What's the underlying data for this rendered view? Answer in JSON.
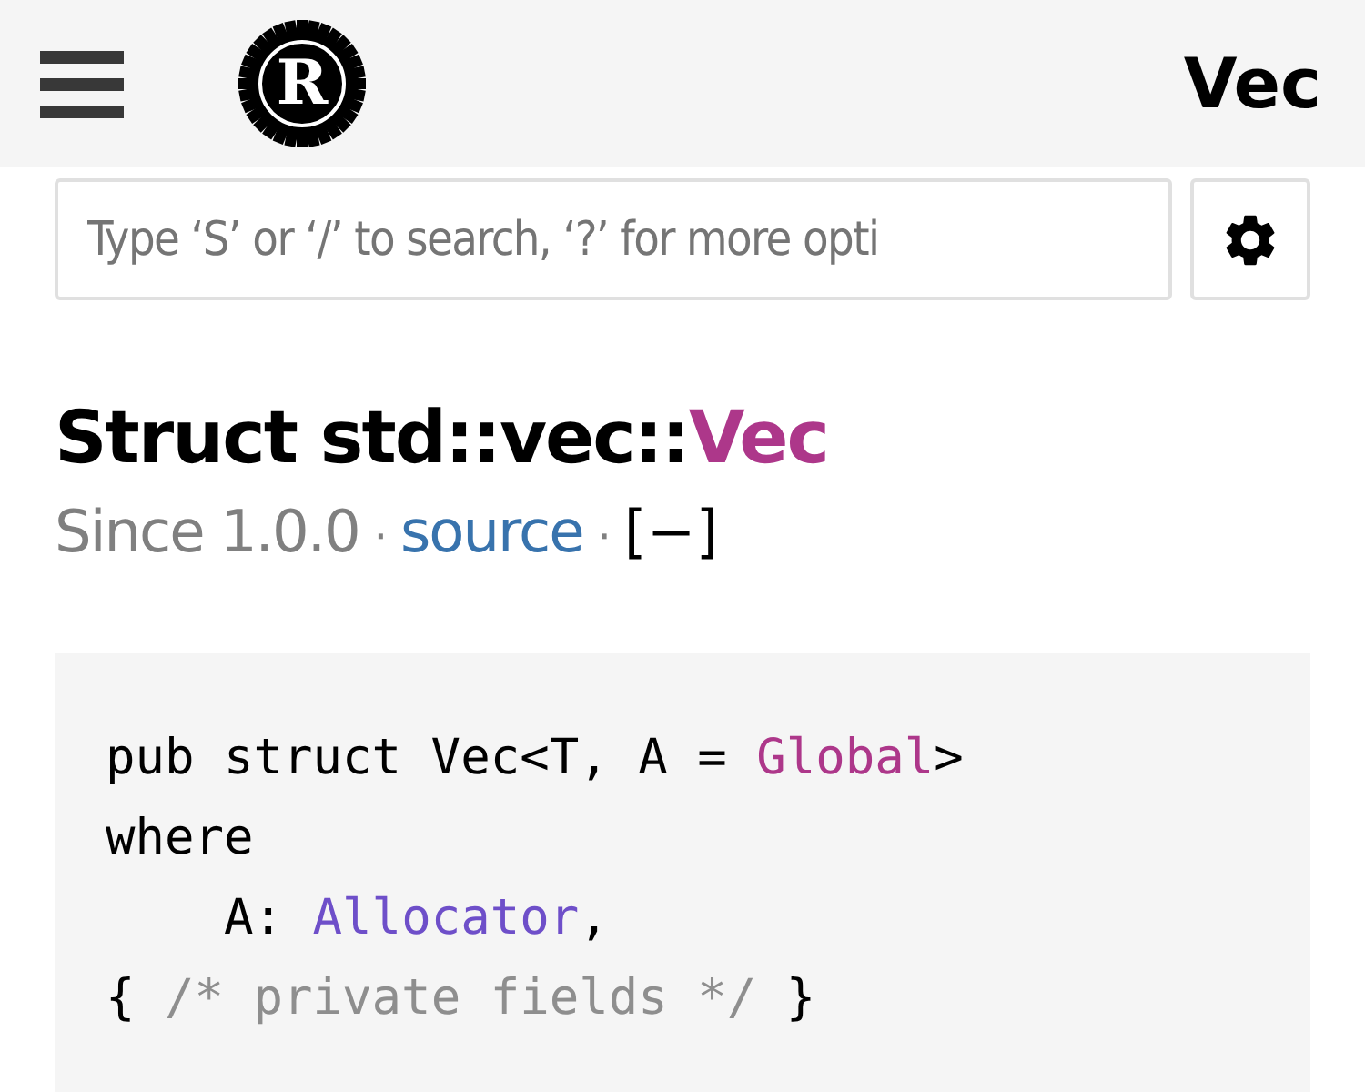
{
  "header": {
    "logo_letter": "R",
    "title": "Vec"
  },
  "search": {
    "placeholder": "Type ‘S’ or ‘/’ to search, ‘?’ for more opti"
  },
  "heading": {
    "prefix": "Struct std::vec::",
    "name": "Vec"
  },
  "meta": {
    "since": "Since 1.0.0",
    "separator": "·",
    "source_link": "source",
    "toggle": "[−]"
  },
  "code": [
    [
      {
        "kind": "plain",
        "text": "pub struct Vec<T, A = "
      },
      {
        "kind": "type",
        "text": "Global"
      },
      {
        "kind": "plain",
        "text": ">"
      }
    ],
    [
      {
        "kind": "plain",
        "text": "where"
      }
    ],
    [
      {
        "kind": "plain",
        "text": "    A: "
      },
      {
        "kind": "trait",
        "text": "Allocator"
      },
      {
        "kind": "plain",
        "text": ","
      }
    ],
    [
      {
        "kind": "plain",
        "text": "{ "
      },
      {
        "kind": "comment",
        "text": "/* private fields */"
      },
      {
        "kind": "plain",
        "text": " }"
      }
    ]
  ]
}
